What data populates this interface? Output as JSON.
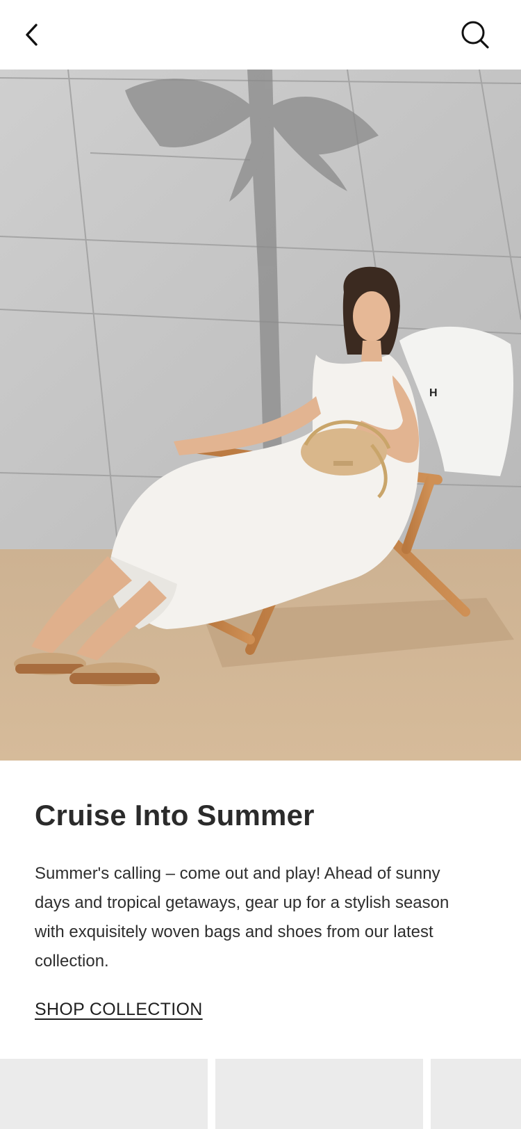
{
  "header": {
    "back_icon": "chevron-left-icon",
    "search_icon": "search-icon"
  },
  "hero": {
    "towel_text": "H"
  },
  "article": {
    "title": "Cruise Into Summer",
    "body": "Summer's calling – come out and play! Ahead of sunny days and tropical getaways, gear up for a stylish season with exquisitely woven bags and shoes from our latest collection.",
    "cta_label": "SHOP COLLECTION"
  },
  "colors": {
    "text": "#2b2b2b",
    "card_placeholder": "#ebebeb",
    "wall": "#c8c8c8",
    "floor": "#d2b491"
  }
}
